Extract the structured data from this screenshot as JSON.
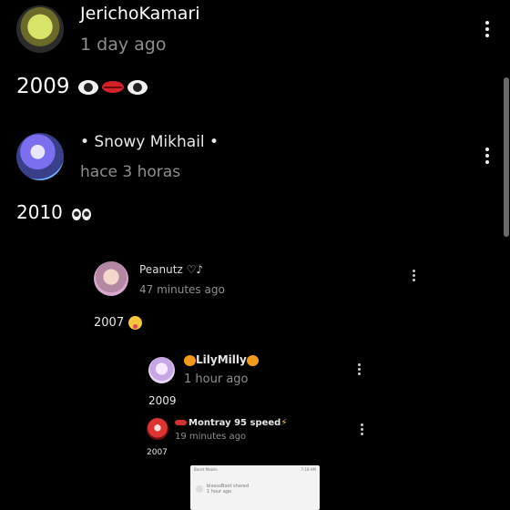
{
  "comments": [
    {
      "username": "JerichoKamari",
      "time": "1 day ago",
      "text": "2009"
    },
    {
      "username": "• Snowy Mikhail •",
      "time": "hace 3 horas",
      "text": "2010"
    }
  ],
  "screenshot": {
    "comments": [
      {
        "username": "Peanutz ♡♪",
        "time": "47 minutes ago",
        "text": "2007"
      },
      {
        "username": "LilyMilly",
        "time": "1 hour ago",
        "text": "2009"
      },
      {
        "username": "Montray 95 speed",
        "time": "19 minutes ago",
        "text": "2007"
      }
    ],
    "mini": {
      "status_left": "Boost Mobile",
      "status_time": "7:18 AM",
      "username": "blossoBoot",
      "action": "shared",
      "time": "1 hour ago"
    }
  },
  "icons": {
    "menu": "kebab-menu-icon",
    "eye": "eye-icon",
    "lips": "lips-icon",
    "tongue": "tongue-emoji-icon",
    "pumpkin": "pumpkin-icon",
    "race_car": "race-car-icon",
    "bolt": "lightning-icon"
  },
  "colors": {
    "background": "#000000",
    "secondary_text": "#8e8e8e"
  }
}
